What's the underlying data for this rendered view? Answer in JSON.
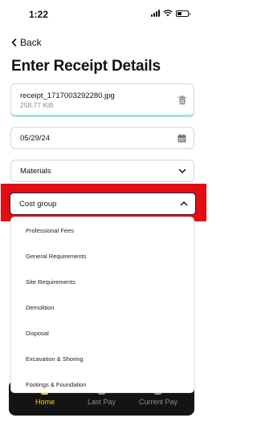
{
  "status_bar": {
    "time": "1:22"
  },
  "nav": {
    "back_label": "Back"
  },
  "page": {
    "title": "Enter Receipt Details"
  },
  "receipt": {
    "file_name": "receipt_1717003292280.jpg",
    "file_size": "258.77 KiB"
  },
  "date_field": {
    "value": "05/29/24"
  },
  "materials_select": {
    "value": "Materials"
  },
  "cost_group_select": {
    "placeholder": "Cost group",
    "expanded": true,
    "options": [
      "Professional Fees",
      "General Requirements",
      "Site Requirements",
      "Demolition",
      "Disposal",
      "Excavation & Shoring",
      "Footings & Foundation"
    ]
  },
  "tab_bar": {
    "tabs": [
      {
        "label": "Home",
        "active": true
      },
      {
        "label": "Last Pay",
        "active": false
      },
      {
        "label": "Current Pay",
        "active": false
      }
    ]
  },
  "colors": {
    "highlight": "#e30d14",
    "accent_green": "#a8e3cf",
    "tab_active": "#f2d024",
    "tab_bar_bg": "#141414"
  }
}
